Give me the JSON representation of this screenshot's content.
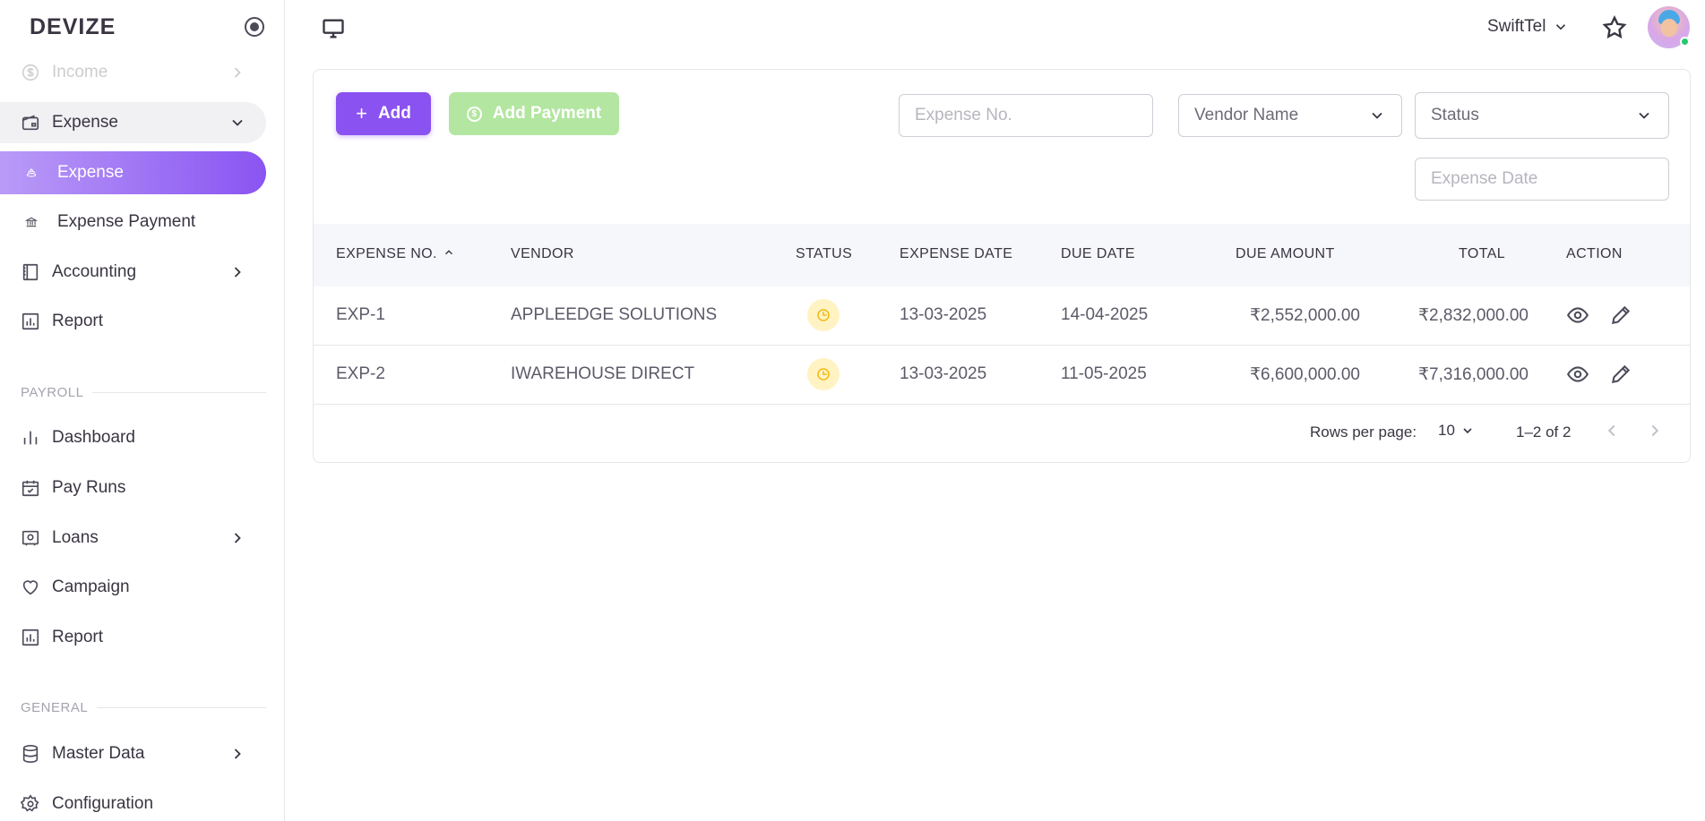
{
  "brand": "DEVIZE",
  "sidebar": {
    "items": [
      {
        "label": "Income"
      },
      {
        "label": "Expense"
      },
      {
        "label": "Expense"
      },
      {
        "label": "Expense Payment"
      },
      {
        "label": "Accounting"
      },
      {
        "label": "Report"
      }
    ],
    "payroll_section": "PAYROLL",
    "payroll_items": [
      {
        "label": "Dashboard"
      },
      {
        "label": "Pay Runs"
      },
      {
        "label": "Loans"
      },
      {
        "label": "Campaign"
      },
      {
        "label": "Report"
      }
    ],
    "general_section": "GENERAL",
    "general_items": [
      {
        "label": "Master Data"
      },
      {
        "label": "Configuration"
      }
    ]
  },
  "topbar": {
    "company": "SwiftTel",
    "icons": [
      "monitor-icon",
      "star-icon",
      "avatar"
    ],
    "online_color": "#28c76f"
  },
  "toolbar": {
    "add_label": "Add",
    "add_payment_label": "Add Payment"
  },
  "filters": {
    "expense_no_placeholder": "Expense No.",
    "vendor_select": "Vendor Name",
    "status_select": "Status",
    "expense_date_placeholder": "Expense Date"
  },
  "table": {
    "headers": [
      "EXPENSE NO.",
      "VENDOR",
      "STATUS",
      "EXPENSE DATE",
      "DUE DATE",
      "DUE AMOUNT",
      "TOTAL",
      "ACTION"
    ],
    "rows": [
      {
        "no": "EXP-1",
        "vendor": "APPLEEDGE SOLUTIONS",
        "status": "pending",
        "expense_date": "13-03-2025",
        "due_date": "14-04-2025",
        "due_amount": "₹2,552,000.00",
        "total": "₹2,832,000.00"
      },
      {
        "no": "EXP-2",
        "vendor": "IWAREHOUSE DIRECT",
        "status": "pending",
        "expense_date": "13-03-2025",
        "due_date": "11-05-2025",
        "due_amount": "₹6,600,000.00",
        "total": "₹7,316,000.00"
      }
    ]
  },
  "pagination": {
    "rows_per_page_label": "Rows per page:",
    "rows_per_page": "10",
    "range": "1–2 of 2"
  },
  "colors": {
    "accent": "#8a52f0",
    "add_payment_disabled": "#b3e6a0",
    "pending_status": "#f2b90f"
  }
}
